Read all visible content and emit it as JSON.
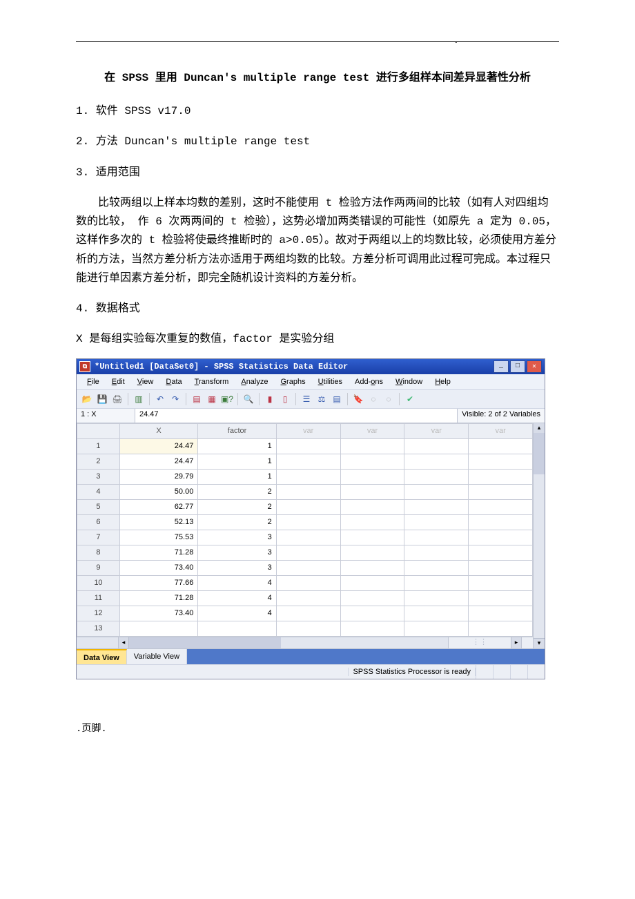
{
  "doc": {
    "top_dot": ".",
    "title": "在 SPSS 里用 Duncan's multiple range test 进行多组样本间差异显著性分析",
    "line1": "1.  软件 SPSS  v17.0",
    "line2": "2.  方法 Duncan's  multiple  range  test",
    "line3": "3.  适用范围",
    "para": "比较两组以上样本均数的差别，这时不能使用 t 检验方法作两两间的比较（如有人对四组均数的比较， 作 6 次两两间的 t 检验），这势必增加两类错误的可能性（如原先 a 定为 0.05，这样作多次的 t 检验将使最终推断时的 a>0.05）。故对于两组以上的均数比较，必须使用方差分析的方法，当然方差分析方法亦适用于两组均数的比较。方差分析可调用此过程可完成。本过程只能进行单因素方差分析，即完全随机设计资料的方差分析。",
    "line4": "4.  数据格式",
    "line5": "X 是每组实验每次重复的数值，factor 是实验分组",
    "footer": ".页脚."
  },
  "spss": {
    "title": "*Untitled1 [DataSet0] - SPSS Statistics Data Editor",
    "menus": [
      "File",
      "Edit",
      "View",
      "Data",
      "Transform",
      "Analyze",
      "Graphs",
      "Utilities",
      "Add-ons",
      "Window",
      "Help"
    ],
    "menu_keys": [
      "F",
      "E",
      "V",
      "D",
      "T",
      "A",
      "G",
      "U",
      "o",
      "W",
      "H"
    ],
    "cell_id": "1 : X",
    "cell_val": "24.47",
    "visible_label": "Visible: 2 of 2 Variables",
    "columns": [
      "X",
      "factor",
      "var",
      "var",
      "var",
      "var"
    ],
    "rows": [
      {
        "n": "1",
        "x": "24.47",
        "f": "1"
      },
      {
        "n": "2",
        "x": "24.47",
        "f": "1"
      },
      {
        "n": "3",
        "x": "29.79",
        "f": "1"
      },
      {
        "n": "4",
        "x": "50.00",
        "f": "2"
      },
      {
        "n": "5",
        "x": "62.77",
        "f": "2"
      },
      {
        "n": "6",
        "x": "52.13",
        "f": "2"
      },
      {
        "n": "7",
        "x": "75.53",
        "f": "3"
      },
      {
        "n": "8",
        "x": "71.28",
        "f": "3"
      },
      {
        "n": "9",
        "x": "73.40",
        "f": "3"
      },
      {
        "n": "10",
        "x": "77.66",
        "f": "4"
      },
      {
        "n": "11",
        "x": "71.28",
        "f": "4"
      },
      {
        "n": "12",
        "x": "73.40",
        "f": "4"
      },
      {
        "n": "13",
        "x": "",
        "f": ""
      }
    ],
    "tabs": {
      "data": "Data View",
      "var": "Variable View"
    },
    "status_msg": "SPSS Statistics Processor is ready"
  }
}
